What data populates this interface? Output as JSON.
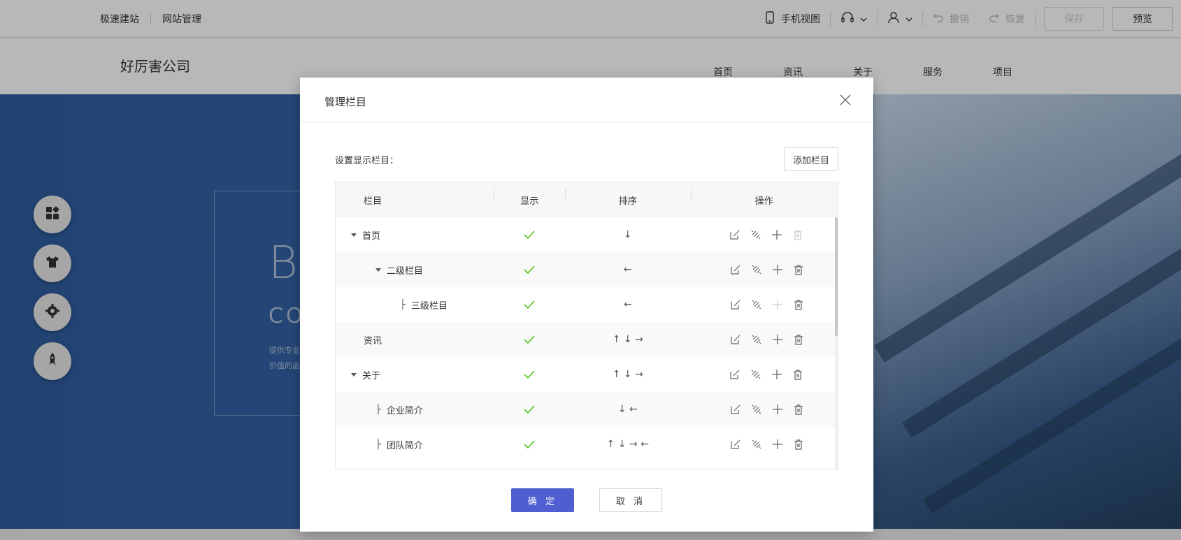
{
  "topbar": {
    "left_links": [
      "极速建站",
      "网站管理"
    ],
    "mobile_view": "手机视图",
    "undo": "撤销",
    "redo": "恢复",
    "save": "保存",
    "preview": "预览"
  },
  "site": {
    "logo": "好厉害公司",
    "nav": [
      "首页",
      "资讯",
      "关于",
      "服务",
      "项目"
    ],
    "hero_big": "B",
    "hero_sub": "CO",
    "hero_desc_1": "提供专业",
    "hero_desc_2": "价值的品"
  },
  "modal": {
    "title": "管理栏目",
    "settings_label": "设置显示栏目：",
    "add_button": "添加栏目",
    "columns": {
      "name": "栏目",
      "show": "显示",
      "sort": "排序",
      "op": "操作"
    },
    "rows": [
      {
        "label": "首页",
        "arrows": "↓",
        "check": "✓"
      },
      {
        "label": "二级栏目",
        "arrows": "←",
        "check": "✓"
      },
      {
        "label": "三级栏目",
        "arrows": "←",
        "check": "✓"
      },
      {
        "label": "资讯",
        "arrows": "↑ ↓ →",
        "check": "✓"
      },
      {
        "label": "关于",
        "arrows": "↑ ↓ →",
        "check": "✓"
      },
      {
        "label": "企业简介",
        "arrows": "↓ ←",
        "check": "✓"
      },
      {
        "label": "团队简介",
        "arrows": "↑ ↓ → ←",
        "check": "✓"
      }
    ],
    "ok": "确 定",
    "cancel": "取 消"
  },
  "colors": {
    "accent": "#4f5fd1",
    "check": "#52c41a"
  }
}
